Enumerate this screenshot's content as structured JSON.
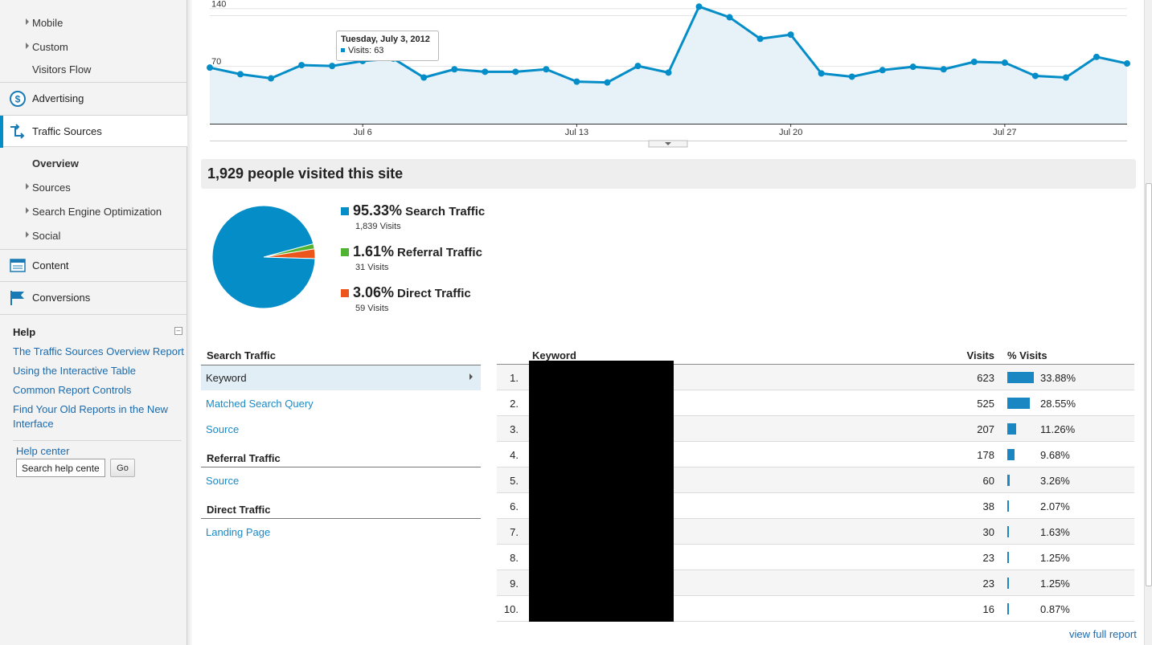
{
  "sidebar": {
    "audience_subitems": [
      "Mobile",
      "Custom",
      "Visitors Flow"
    ],
    "sections": {
      "advertising": "Advertising",
      "traffic_sources": "Traffic Sources",
      "content": "Content",
      "conversions": "Conversions"
    },
    "traffic_subitems": [
      "Overview",
      "Sources",
      "Search Engine Optimization",
      "Social"
    ],
    "help": {
      "title": "Help",
      "links": [
        "The Traffic Sources Overview Report",
        "Using the Interactive Table",
        "Common Report Controls",
        "Find Your Old Reports in the New Interface"
      ],
      "center_label": "Help center",
      "search_placeholder": "Search help center",
      "go_label": "Go"
    }
  },
  "chart_data": {
    "type": "area",
    "series": [
      {
        "name": "Visits",
        "values": [
          68,
          60,
          55,
          71,
          70,
          76,
          79,
          56,
          66,
          63,
          63,
          66,
          51,
          50,
          70,
          62,
          142,
          129,
          103,
          108,
          61,
          57,
          65,
          69,
          66,
          75,
          74,
          58,
          56,
          81,
          73
        ]
      }
    ],
    "x": [
      "Jul 1",
      "Jul 2",
      "Jul 3",
      "Jul 4",
      "Jul 5",
      "Jul 6",
      "Jul 7",
      "Jul 8",
      "Jul 9",
      "Jul 10",
      "Jul 11",
      "Jul 12",
      "Jul 13",
      "Jul 14",
      "Jul 15",
      "Jul 16",
      "Jul 17",
      "Jul 18",
      "Jul 19",
      "Jul 20",
      "Jul 21",
      "Jul 22",
      "Jul 23",
      "Jul 24",
      "Jul 25",
      "Jul 26",
      "Jul 27",
      "Jul 28",
      "Jul 29",
      "Jul 30",
      "Jul 31"
    ],
    "x_tick_labels": [
      "Jul 6",
      "Jul 13",
      "Jul 20",
      "Jul 27"
    ],
    "y_tick_labels": [
      "140",
      "70"
    ],
    "ylim": [
      0,
      150
    ],
    "grid": true,
    "tooltip": {
      "date": "Tuesday, July 3, 2012",
      "text": "Visits: 63"
    }
  },
  "summary": {
    "title": "1,929 people visited this site"
  },
  "pie": {
    "slices": [
      {
        "pct": "95.33%",
        "name": "Search Traffic",
        "visits": "1,839 Visits",
        "value": 95.33,
        "color": "#058dc7"
      },
      {
        "pct": "1.61%",
        "name": "Referral Traffic",
        "visits": "31 Visits",
        "value": 1.61,
        "color": "#50b432"
      },
      {
        "pct": "3.06%",
        "name": "Direct Traffic",
        "visits": "59 Visits",
        "value": 3.06,
        "color": "#ed561b"
      }
    ]
  },
  "left_nav": {
    "search_heading": "Search Traffic",
    "search_items": [
      "Keyword",
      "Matched Search Query",
      "Source"
    ],
    "referral_heading": "Referral Traffic",
    "referral_items": [
      "Source"
    ],
    "direct_heading": "Direct Traffic",
    "direct_items": [
      "Landing Page"
    ]
  },
  "keyword_table": {
    "headers": {
      "keyword": "Keyword",
      "visits": "Visits",
      "pct_visits": "% Visits"
    },
    "rows": [
      {
        "rank": "1.",
        "visits": "623",
        "pct": "33.88%",
        "share": 33.88
      },
      {
        "rank": "2.",
        "visits": "525",
        "pct": "28.55%",
        "share": 28.55
      },
      {
        "rank": "3.",
        "visits": "207",
        "pct": "11.26%",
        "share": 11.26
      },
      {
        "rank": "4.",
        "visits": "178",
        "pct": "9.68%",
        "share": 9.68
      },
      {
        "rank": "5.",
        "visits": "60",
        "pct": "3.26%",
        "share": 3.26
      },
      {
        "rank": "6.",
        "visits": "38",
        "pct": "2.07%",
        "share": 2.07
      },
      {
        "rank": "7.",
        "visits": "30",
        "pct": "1.63%",
        "share": 1.63
      },
      {
        "rank": "8.",
        "visits": "23",
        "pct": "1.25%",
        "share": 1.25
      },
      {
        "rank": "9.",
        "visits": "23",
        "pct": "1.25%",
        "share": 1.25
      },
      {
        "rank": "10.",
        "visits": "16",
        "pct": "0.87%",
        "share": 0.87
      }
    ],
    "view_full": "view full report"
  },
  "colors": {
    "accent": "#058dc7",
    "link": "#1a6aad"
  }
}
